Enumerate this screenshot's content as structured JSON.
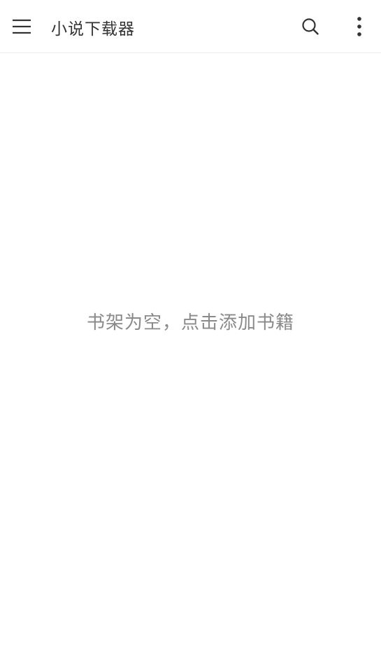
{
  "toolbar": {
    "menu_icon": "hamburger-menu-icon",
    "title": "小说下载器",
    "search_icon": "search-icon",
    "more_icon": "more-vertical-icon"
  },
  "main": {
    "empty_message": "书架为空，点击添加书籍"
  },
  "colors": {
    "background": "#ffffff",
    "title_text": "#333333",
    "icon": "#333333",
    "hint_text": "#8a8a8a",
    "divider": "#ededed"
  }
}
